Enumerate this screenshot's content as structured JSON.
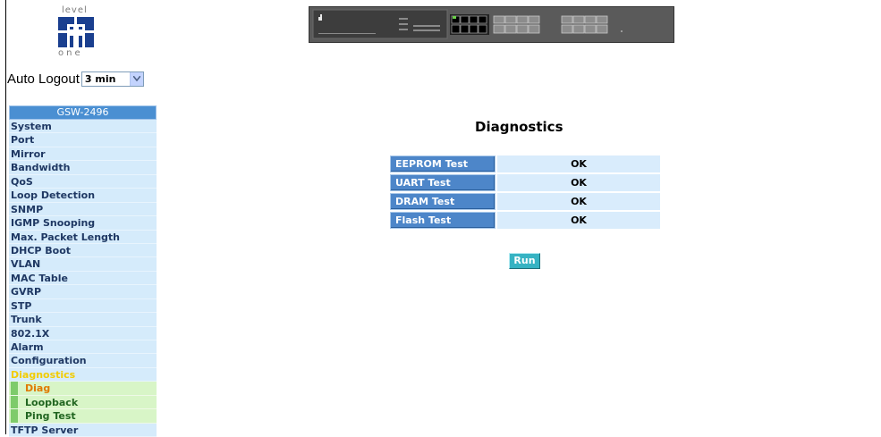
{
  "logo": {
    "top_text": "level",
    "bottom_text": "one"
  },
  "auto_logout": {
    "label": "Auto Logout",
    "selected": "3 min"
  },
  "sidebar": {
    "title": "GSW-2496",
    "items": [
      {
        "label": "System"
      },
      {
        "label": "Port"
      },
      {
        "label": "Mirror"
      },
      {
        "label": "Bandwidth"
      },
      {
        "label": "QoS"
      },
      {
        "label": "Loop Detection"
      },
      {
        "label": "SNMP"
      },
      {
        "label": "IGMP Snooping"
      },
      {
        "label": "Max. Packet Length"
      },
      {
        "label": "DHCP Boot"
      },
      {
        "label": "VLAN"
      },
      {
        "label": "MAC Table"
      },
      {
        "label": "GVRP"
      },
      {
        "label": "STP"
      },
      {
        "label": "Trunk"
      },
      {
        "label": "802.1X"
      },
      {
        "label": "Alarm"
      },
      {
        "label": "Configuration"
      },
      {
        "label": "Diagnostics"
      }
    ],
    "sub_items": [
      {
        "label": "Diag"
      },
      {
        "label": "Loopback"
      },
      {
        "label": "Ping Test"
      }
    ],
    "after_items": [
      {
        "label": "TFTP Server"
      }
    ]
  },
  "main": {
    "heading": "Diagnostics",
    "tests": [
      {
        "label": "EEPROM Test",
        "value": "OK"
      },
      {
        "label": "UART Test",
        "value": "OK"
      },
      {
        "label": "DRAM Test",
        "value": "OK"
      },
      {
        "label": "Flash Test",
        "value": "OK"
      }
    ],
    "run_label": "Run"
  },
  "colors": {
    "menu_bg": "#d5ebfb",
    "menu_text": "#1f3863",
    "active_text": "#f2cc00",
    "sub_bg": "#d8f5c7",
    "sub_text": "#226622",
    "current_text": "#e07a00",
    "label_bg": "#4d86c9",
    "value_bg": "#d9ecfc",
    "run_bg": "#36b3c3"
  }
}
